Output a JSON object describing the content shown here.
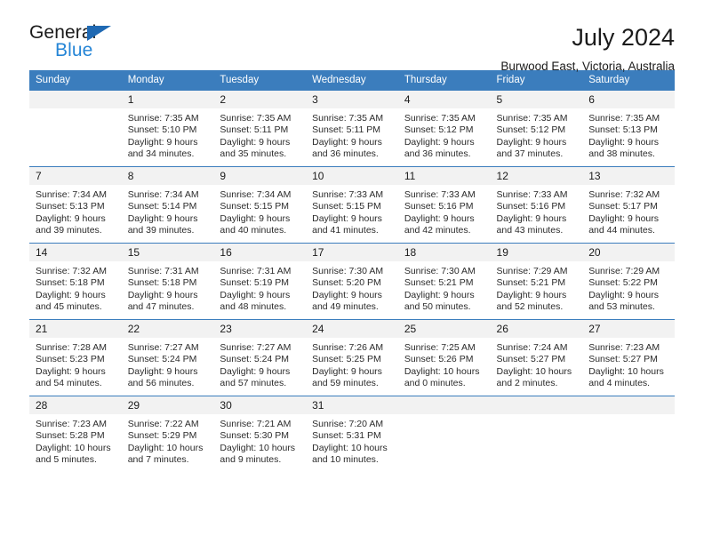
{
  "logo": {
    "word1": "General",
    "word2": "Blue",
    "triangle_color": "#1f69b3",
    "word2_color": "#2585d6"
  },
  "header": {
    "title": "July 2024",
    "location": "Burwood East, Victoria, Australia"
  },
  "theme": {
    "header_blue": "#3b7dbd",
    "daynum_band": "#f2f2f2",
    "text": "#1a1a1a"
  },
  "calendar": {
    "weekday_headers": [
      "Sunday",
      "Monday",
      "Tuesday",
      "Wednesday",
      "Thursday",
      "Friday",
      "Saturday"
    ],
    "weeks": [
      [
        {
          "day": "",
          "blank": true,
          "sunrise": "",
          "sunset": "",
          "daylight1": "",
          "daylight2": ""
        },
        {
          "day": "1",
          "sunrise": "Sunrise: 7:35 AM",
          "sunset": "Sunset: 5:10 PM",
          "daylight1": "Daylight: 9 hours",
          "daylight2": "and 34 minutes."
        },
        {
          "day": "2",
          "sunrise": "Sunrise: 7:35 AM",
          "sunset": "Sunset: 5:11 PM",
          "daylight1": "Daylight: 9 hours",
          "daylight2": "and 35 minutes."
        },
        {
          "day": "3",
          "sunrise": "Sunrise: 7:35 AM",
          "sunset": "Sunset: 5:11 PM",
          "daylight1": "Daylight: 9 hours",
          "daylight2": "and 36 minutes."
        },
        {
          "day": "4",
          "sunrise": "Sunrise: 7:35 AM",
          "sunset": "Sunset: 5:12 PM",
          "daylight1": "Daylight: 9 hours",
          "daylight2": "and 36 minutes."
        },
        {
          "day": "5",
          "sunrise": "Sunrise: 7:35 AM",
          "sunset": "Sunset: 5:12 PM",
          "daylight1": "Daylight: 9 hours",
          "daylight2": "and 37 minutes."
        },
        {
          "day": "6",
          "sunrise": "Sunrise: 7:35 AM",
          "sunset": "Sunset: 5:13 PM",
          "daylight1": "Daylight: 9 hours",
          "daylight2": "and 38 minutes."
        }
      ],
      [
        {
          "day": "7",
          "sunrise": "Sunrise: 7:34 AM",
          "sunset": "Sunset: 5:13 PM",
          "daylight1": "Daylight: 9 hours",
          "daylight2": "and 39 minutes."
        },
        {
          "day": "8",
          "sunrise": "Sunrise: 7:34 AM",
          "sunset": "Sunset: 5:14 PM",
          "daylight1": "Daylight: 9 hours",
          "daylight2": "and 39 minutes."
        },
        {
          "day": "9",
          "sunrise": "Sunrise: 7:34 AM",
          "sunset": "Sunset: 5:15 PM",
          "daylight1": "Daylight: 9 hours",
          "daylight2": "and 40 minutes."
        },
        {
          "day": "10",
          "sunrise": "Sunrise: 7:33 AM",
          "sunset": "Sunset: 5:15 PM",
          "daylight1": "Daylight: 9 hours",
          "daylight2": "and 41 minutes."
        },
        {
          "day": "11",
          "sunrise": "Sunrise: 7:33 AM",
          "sunset": "Sunset: 5:16 PM",
          "daylight1": "Daylight: 9 hours",
          "daylight2": "and 42 minutes."
        },
        {
          "day": "12",
          "sunrise": "Sunrise: 7:33 AM",
          "sunset": "Sunset: 5:16 PM",
          "daylight1": "Daylight: 9 hours",
          "daylight2": "and 43 minutes."
        },
        {
          "day": "13",
          "sunrise": "Sunrise: 7:32 AM",
          "sunset": "Sunset: 5:17 PM",
          "daylight1": "Daylight: 9 hours",
          "daylight2": "and 44 minutes."
        }
      ],
      [
        {
          "day": "14",
          "sunrise": "Sunrise: 7:32 AM",
          "sunset": "Sunset: 5:18 PM",
          "daylight1": "Daylight: 9 hours",
          "daylight2": "and 45 minutes."
        },
        {
          "day": "15",
          "sunrise": "Sunrise: 7:31 AM",
          "sunset": "Sunset: 5:18 PM",
          "daylight1": "Daylight: 9 hours",
          "daylight2": "and 47 minutes."
        },
        {
          "day": "16",
          "sunrise": "Sunrise: 7:31 AM",
          "sunset": "Sunset: 5:19 PM",
          "daylight1": "Daylight: 9 hours",
          "daylight2": "and 48 minutes."
        },
        {
          "day": "17",
          "sunrise": "Sunrise: 7:30 AM",
          "sunset": "Sunset: 5:20 PM",
          "daylight1": "Daylight: 9 hours",
          "daylight2": "and 49 minutes."
        },
        {
          "day": "18",
          "sunrise": "Sunrise: 7:30 AM",
          "sunset": "Sunset: 5:21 PM",
          "daylight1": "Daylight: 9 hours",
          "daylight2": "and 50 minutes."
        },
        {
          "day": "19",
          "sunrise": "Sunrise: 7:29 AM",
          "sunset": "Sunset: 5:21 PM",
          "daylight1": "Daylight: 9 hours",
          "daylight2": "and 52 minutes."
        },
        {
          "day": "20",
          "sunrise": "Sunrise: 7:29 AM",
          "sunset": "Sunset: 5:22 PM",
          "daylight1": "Daylight: 9 hours",
          "daylight2": "and 53 minutes."
        }
      ],
      [
        {
          "day": "21",
          "sunrise": "Sunrise: 7:28 AM",
          "sunset": "Sunset: 5:23 PM",
          "daylight1": "Daylight: 9 hours",
          "daylight2": "and 54 minutes."
        },
        {
          "day": "22",
          "sunrise": "Sunrise: 7:27 AM",
          "sunset": "Sunset: 5:24 PM",
          "daylight1": "Daylight: 9 hours",
          "daylight2": "and 56 minutes."
        },
        {
          "day": "23",
          "sunrise": "Sunrise: 7:27 AM",
          "sunset": "Sunset: 5:24 PM",
          "daylight1": "Daylight: 9 hours",
          "daylight2": "and 57 minutes."
        },
        {
          "day": "24",
          "sunrise": "Sunrise: 7:26 AM",
          "sunset": "Sunset: 5:25 PM",
          "daylight1": "Daylight: 9 hours",
          "daylight2": "and 59 minutes."
        },
        {
          "day": "25",
          "sunrise": "Sunrise: 7:25 AM",
          "sunset": "Sunset: 5:26 PM",
          "daylight1": "Daylight: 10 hours",
          "daylight2": "and 0 minutes."
        },
        {
          "day": "26",
          "sunrise": "Sunrise: 7:24 AM",
          "sunset": "Sunset: 5:27 PM",
          "daylight1": "Daylight: 10 hours",
          "daylight2": "and 2 minutes."
        },
        {
          "day": "27",
          "sunrise": "Sunrise: 7:23 AM",
          "sunset": "Sunset: 5:27 PM",
          "daylight1": "Daylight: 10 hours",
          "daylight2": "and 4 minutes."
        }
      ],
      [
        {
          "day": "28",
          "sunrise": "Sunrise: 7:23 AM",
          "sunset": "Sunset: 5:28 PM",
          "daylight1": "Daylight: 10 hours",
          "daylight2": "and 5 minutes."
        },
        {
          "day": "29",
          "sunrise": "Sunrise: 7:22 AM",
          "sunset": "Sunset: 5:29 PM",
          "daylight1": "Daylight: 10 hours",
          "daylight2": "and 7 minutes."
        },
        {
          "day": "30",
          "sunrise": "Sunrise: 7:21 AM",
          "sunset": "Sunset: 5:30 PM",
          "daylight1": "Daylight: 10 hours",
          "daylight2": "and 9 minutes."
        },
        {
          "day": "31",
          "sunrise": "Sunrise: 7:20 AM",
          "sunset": "Sunset: 5:31 PM",
          "daylight1": "Daylight: 10 hours",
          "daylight2": "and 10 minutes."
        },
        {
          "day": "",
          "blank": true,
          "sunrise": "",
          "sunset": "",
          "daylight1": "",
          "daylight2": ""
        },
        {
          "day": "",
          "blank": true,
          "sunrise": "",
          "sunset": "",
          "daylight1": "",
          "daylight2": ""
        },
        {
          "day": "",
          "blank": true,
          "sunrise": "",
          "sunset": "",
          "daylight1": "",
          "daylight2": ""
        }
      ]
    ]
  }
}
